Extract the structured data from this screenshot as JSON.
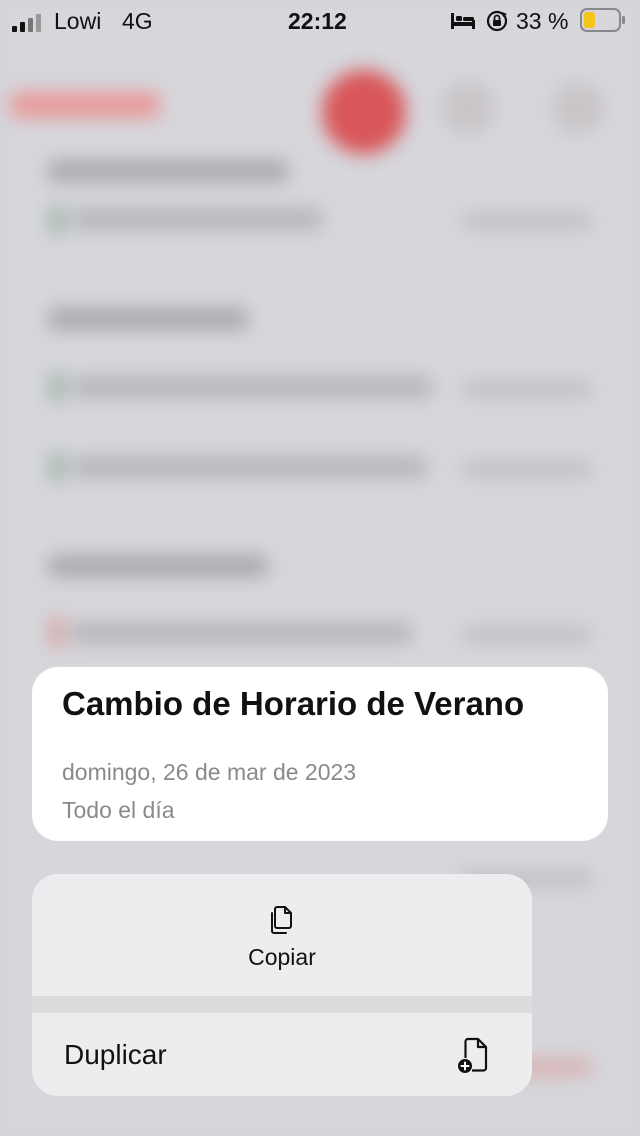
{
  "status_bar": {
    "carrier": "Lowi",
    "network": "4G",
    "time": "22:12",
    "battery_percent": "33 %",
    "battery_color": "#f5c518",
    "icons": [
      "signal-icon",
      "bed-icon",
      "orientation-lock-icon",
      "battery-icon"
    ]
  },
  "event": {
    "title": "Cambio de Horario de Verano",
    "date": "domingo, 26 de mar de 2023",
    "time_label": "Todo el día"
  },
  "context_menu": {
    "copy": {
      "label": "Copiar",
      "icon": "copy-icon"
    },
    "duplicate": {
      "label": "Duplicar",
      "icon": "duplicate-icon"
    }
  },
  "colors": {
    "accent_red": "#d9575a",
    "secondary_text": "#8a8a8e"
  }
}
